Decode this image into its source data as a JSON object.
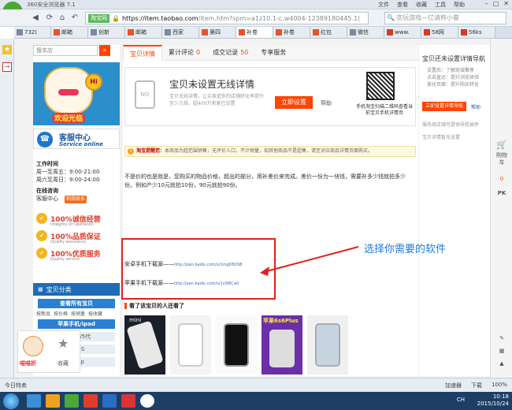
{
  "browser": {
    "title": "360安全浏览器 7.1",
    "menu": [
      "文件",
      "查看",
      "收藏",
      "工具",
      "帮助"
    ],
    "addr_tag": "淘宝网",
    "url_host": "https://item.taobao.com",
    "url_rest": "/item.htm?spm=a1z10.1-c.w4004-12389180445.1(",
    "search_placeholder": "贪玩游戏—亿请称小眷",
    "tabs": [
      "732(",
      "邮箱",
      "创新",
      "邮箱",
      "西家",
      "第四",
      "补卷",
      "补卷",
      "红包",
      "微信",
      "www.",
      "58网",
      "56ks"
    ],
    "status_left": "今日特卖",
    "status_right": [
      "加速器",
      "下载",
      "100%"
    ]
  },
  "shop": {
    "search_placeholder": "搜本店",
    "banner_welcome": "欢迎光临",
    "service_title": "客服中心",
    "service_sub": "Service online",
    "worktime_label": "工作时间",
    "worktime_1": "周一至周五：9:00-21:00",
    "worktime_2": "周六至周日：9:00-24:00",
    "online_label": "在线咨询",
    "online_name": "客服中心",
    "online_btn": "和我联系",
    "badges": [
      {
        "text": "100%诚信经营",
        "sub": "Integrity Of Operation"
      },
      {
        "text": "100%品质保证",
        "sub": "Quality assurance"
      },
      {
        "text": "100%优质服务",
        "sub": "Quality service"
      }
    ],
    "category_title": "宝贝分类",
    "cat_all": "查看所有宝贝",
    "cat_sub": [
      "按新品",
      "按价格",
      "按销量",
      "按收藏"
    ],
    "cat_apple": "苹果手机/ipad",
    "cat_items": [
      "4代/4S/5代",
      "5C/5S",
      "6P/6p"
    ],
    "float_name": "喵喵折",
    "float_fav": "收藏"
  },
  "main": {
    "tabs": [
      {
        "label": "宝贝详情",
        "num": ""
      },
      {
        "label": "累计评论",
        "num": "0"
      },
      {
        "label": "成交记录",
        "num": "50"
      },
      {
        "label": "专享服务",
        "num": ""
      }
    ],
    "wl_title": "宝贝未设置无线详情",
    "wl_desc": "宝贝无线详情，让买家逛你的店铺转化率提升至少几倍，超400万卖家已设置",
    "wl_btn": "立即设置",
    "wl_help": "帮助",
    "qr_text": "手机淘宝扫描二维码查看当前宝贝手机详情页",
    "notice_label": "淘宝提醒您：",
    "notice_text": "本商品为超范围销售，无评价入口，不计销量，如其他商品不是超售，请至对应商品详情页面购买。",
    "desc_text": "不是价的也是就是，您购买的物品价格，超出的部分，用补差价来完成。差价一份为一块钱，需要补多少钱就拍多少份。例如产少10元就拍10份，90元就拍90份。",
    "android_label": "安卓手机下载源——",
    "android_url": "http://pan.baidu.com/s/1mgDB298",
    "apple_label": "苹果手机下载源——",
    "apple_url": "http://pan.baidu.com/s/1c0I6Ca0",
    "youmay": "看了该宝贝的人还看了",
    "thumb_labels": [
      "mini",
      "",
      "",
      "苹果6s6Plus",
      ""
    ]
  },
  "right": {
    "title": "宝贝还未设置详情导航",
    "list": [
      "设置后：了解商城聚焦",
      "点击直达：提升浏览体验",
      "美化页面：提升购买转化"
    ],
    "btn": "立即设置详情导航",
    "help": "帮助",
    "note1": "服务商店铺可提供导航插件",
    "note2": "宝贝详情暂无设置"
  },
  "hint": "选择你需要的软件",
  "rightstrip": {
    "cart": "购物车",
    "count": "0",
    "pk": "PK"
  },
  "tray": {
    "lang": "CH",
    "time": "10:18",
    "date": "2015/10/24"
  },
  "colors": {
    "taobao_orange": "#ff4400",
    "link_blue": "#1e7ae0",
    "annotation_red": "#e0221b"
  }
}
